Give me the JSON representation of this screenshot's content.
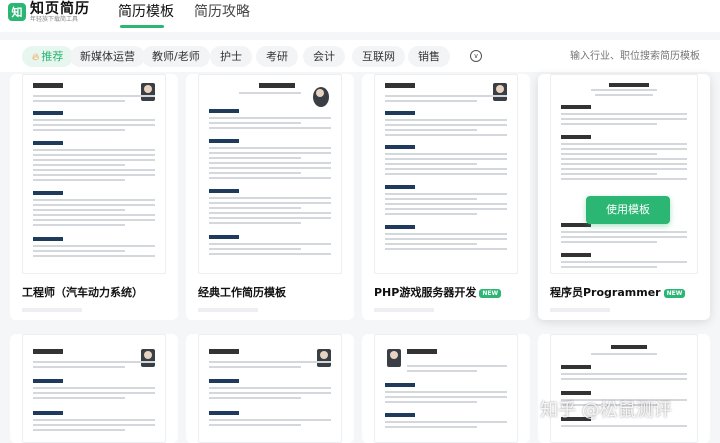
{
  "header": {
    "logo_name": "知页简历",
    "logo_sub": "年轻族下载简工具",
    "logo_mark": "知",
    "nav": [
      "简历模板",
      "简历攻略"
    ]
  },
  "categories": {
    "items": [
      "推荐",
      "新媒体运营",
      "教师/老师",
      "护士",
      "考研",
      "会计",
      "互联网",
      "销售"
    ],
    "active": "推荐",
    "search_placeholder": "输入行业、职位搜索简历模板"
  },
  "cards": [
    {
      "title": "工程师（汽车动力系统）",
      "new": false
    },
    {
      "title": "经典工作简历模板",
      "new": false
    },
    {
      "title": "PHP游戏服务器开发",
      "new": true
    },
    {
      "title": "程序员Programmer",
      "new": true
    }
  ],
  "new_badge": "NEW",
  "use_button": "使用模板",
  "watermark": "知乎 @松鼠测评",
  "colors": {
    "accent": "#2bb673",
    "dark_section": "#1f3b5c"
  }
}
